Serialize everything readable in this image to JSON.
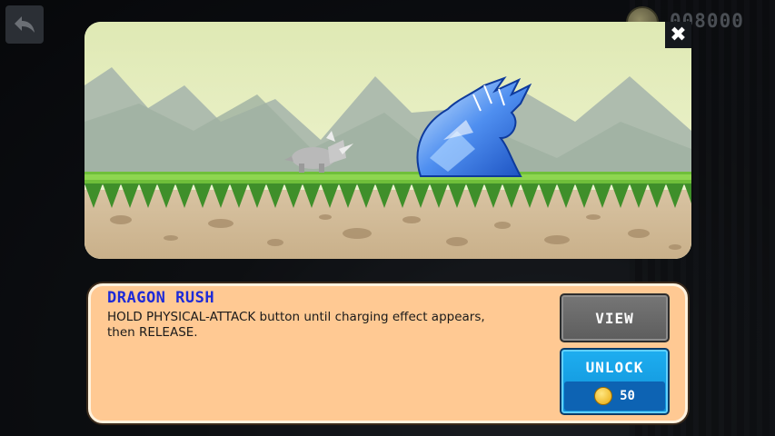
{
  "hud": {
    "coin_balance": "008000"
  },
  "skill": {
    "name": "DRAGON RUSH",
    "description": "HOLD PHYSICAL-ATTACK button until charging effect appears, then RELEASE."
  },
  "buttons": {
    "view_label": "VIEW",
    "unlock_label": "UNLOCK",
    "unlock_price": "50"
  },
  "icons": {
    "back": "back-arrow-icon",
    "close": "close-icon",
    "coin": "coin-icon"
  },
  "colors": {
    "title": "#1d2ad8",
    "panel": "#ffc993",
    "unlock_button": "#1eaef0",
    "view_button": "#6a6a6a"
  }
}
